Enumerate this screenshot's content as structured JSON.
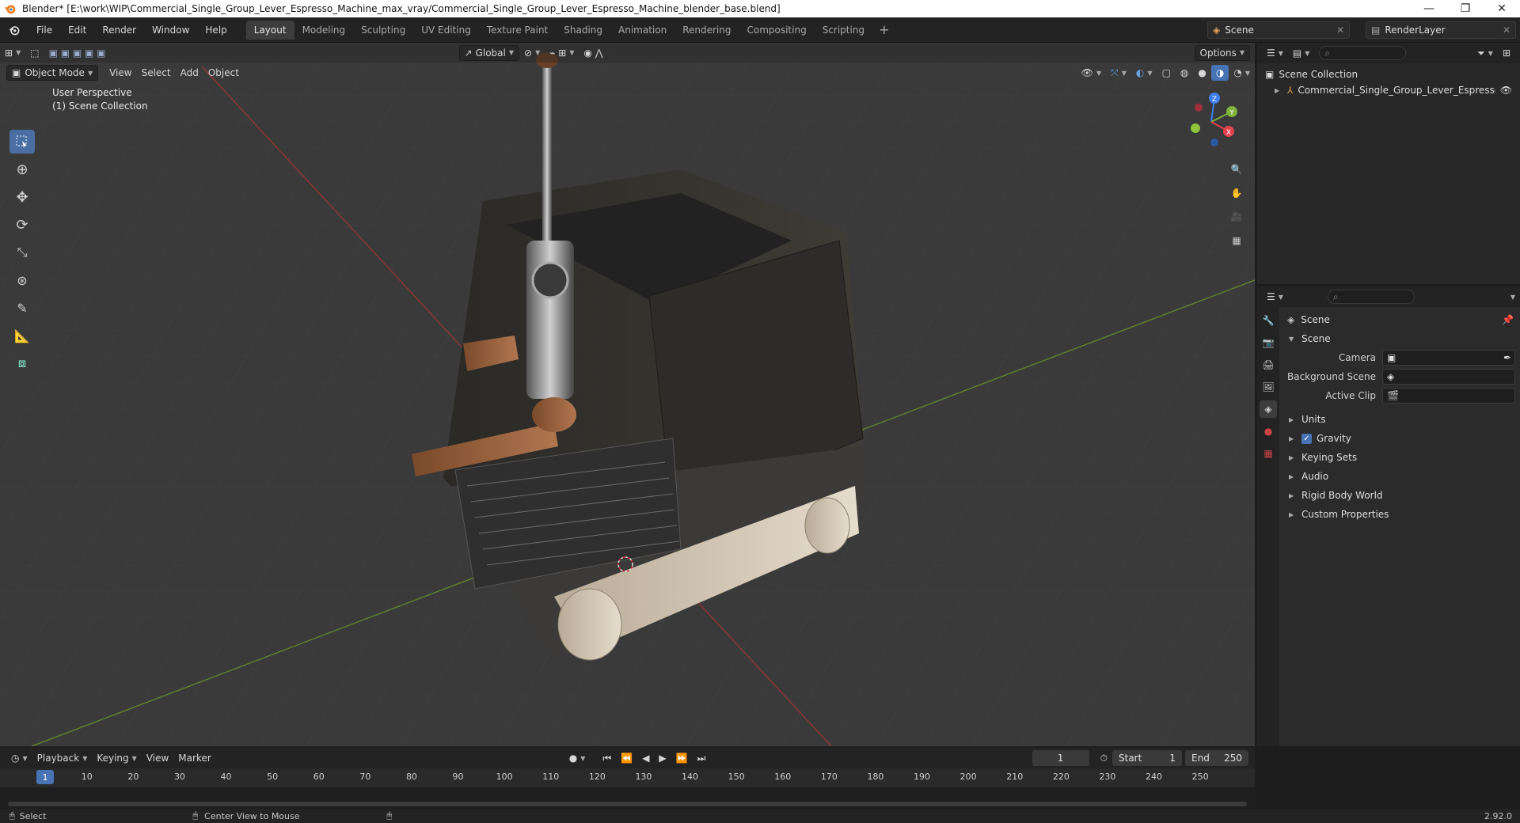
{
  "window": {
    "title": "Blender* [E:\\work\\WIP\\Commercial_Single_Group_Lever_Espresso_Machine_max_vray/Commercial_Single_Group_Lever_Espresso_Machine_blender_base.blend]",
    "controls": [
      "—",
      "❐",
      "✕"
    ]
  },
  "menu": [
    "File",
    "Edit",
    "Render",
    "Window",
    "Help"
  ],
  "workspaces": [
    "Layout",
    "Modeling",
    "Sculpting",
    "UV Editing",
    "Texture Paint",
    "Shading",
    "Animation",
    "Rendering",
    "Compositing",
    "Scripting"
  ],
  "active_workspace": "Layout",
  "scene_field": "Scene",
  "renderlayer_field": "RenderLayer",
  "viewport": {
    "mode": "Object Mode",
    "header_menus": [
      "View",
      "Select",
      "Add",
      "Object"
    ],
    "orientation": "Global",
    "options": "Options",
    "perspective": "User Perspective",
    "collection": "(1) Scene Collection",
    "axes": {
      "x": "X",
      "y": "Y",
      "z": "Z"
    }
  },
  "outliner": {
    "root": "Scene Collection",
    "item": "Commercial_Single_Group_Lever_Espresso_l"
  },
  "properties": {
    "context": "Scene",
    "panel": "Scene",
    "fields": [
      {
        "label": "Camera"
      },
      {
        "label": "Background Scene"
      },
      {
        "label": "Active Clip"
      }
    ],
    "subpanels": [
      "Units",
      "Gravity",
      "Keying Sets",
      "Audio",
      "Rigid Body World",
      "Custom Properties"
    ],
    "gravity_checked": true
  },
  "timeline": {
    "menus": [
      "Playback",
      "Keying",
      "View",
      "Marker"
    ],
    "current_frame": "1",
    "start_label": "Start",
    "start": "1",
    "end_label": "End",
    "end": "250",
    "ticks": [
      "10",
      "20",
      "30",
      "40",
      "50",
      "60",
      "70",
      "80",
      "90",
      "100",
      "110",
      "120",
      "130",
      "140",
      "150",
      "160",
      "170",
      "180",
      "190",
      "200",
      "210",
      "220",
      "230",
      "240",
      "250"
    ],
    "cursor": "1"
  },
  "status": {
    "select": "Select",
    "center": "Center View to Mouse",
    "version": "2.92.0"
  }
}
